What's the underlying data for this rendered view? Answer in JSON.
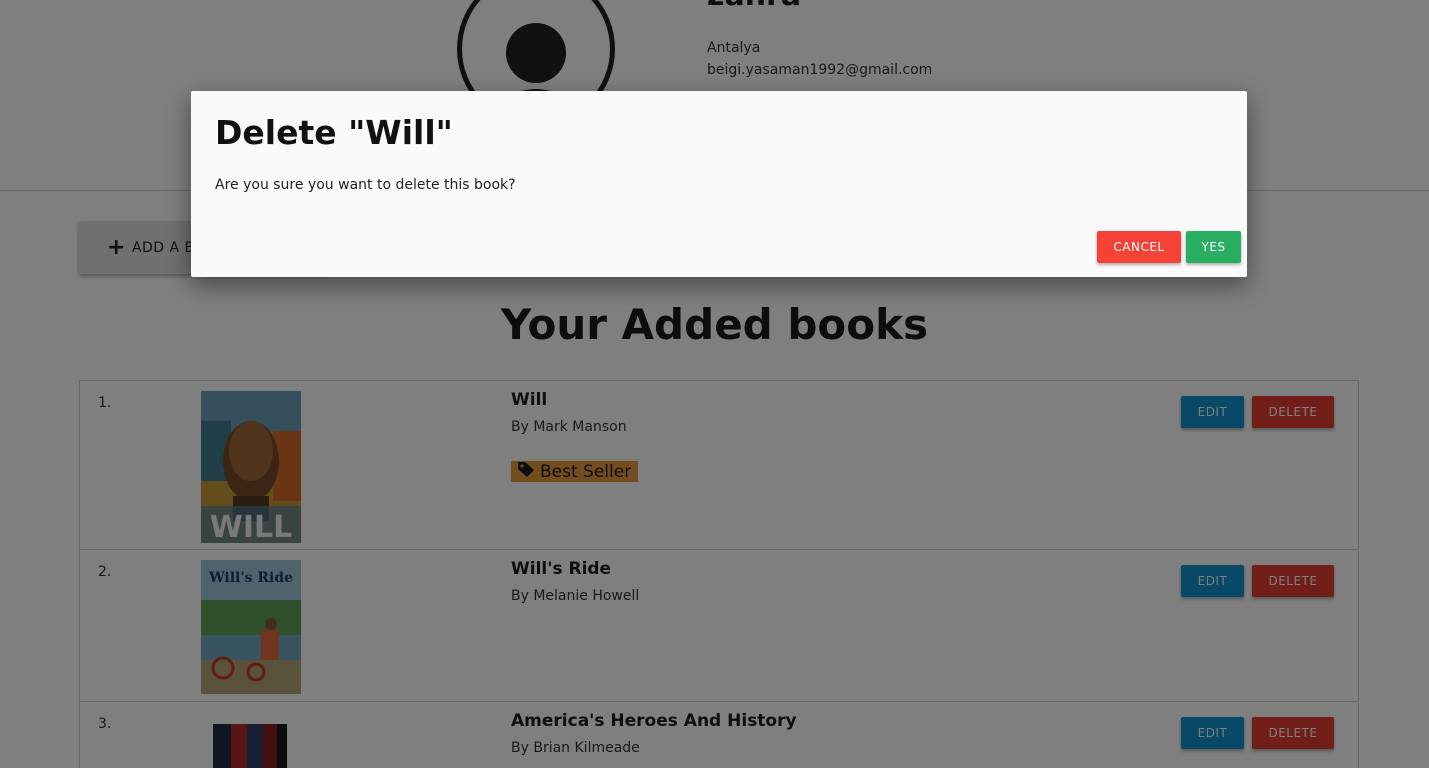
{
  "profile": {
    "name": "zahra",
    "city": "Antalya",
    "email": "beigi.yasaman1992@gmail.com",
    "avatar_icon": "user-avatar-icon"
  },
  "toolbar": {
    "add_book_label": "ADD A BOOK",
    "add_icon": "plus-icon"
  },
  "section_title": "Your Added books",
  "books": [
    {
      "index": "1.",
      "title": "Will",
      "author": "By Mark Manson",
      "badge": "Best Seller",
      "badge_icon": "tag-icon",
      "cover_text": "WILL",
      "edit_label": "EDIT",
      "delete_label": "DELETE"
    },
    {
      "index": "2.",
      "title": "Will's Ride",
      "author": "By Melanie Howell",
      "cover_text": "Will's Ride",
      "edit_label": "EDIT",
      "delete_label": "DELETE"
    },
    {
      "index": "3.",
      "title": "America's Heroes And History",
      "author": "By Brian Kilmeade",
      "edit_label": "EDIT",
      "delete_label": "DELETE"
    }
  ],
  "dialog": {
    "title": "Delete \"Will\"",
    "message": "Are you sure you want to delete this book?",
    "cancel_label": "CANCEL",
    "yes_label": "YES"
  },
  "colors": {
    "edit": "#1392d1",
    "delete": "#e23b30",
    "cancel": "#f44336",
    "yes": "#27ae60",
    "badge": "#e89a3c",
    "overlay": "rgba(0,0,0,0.5)"
  }
}
